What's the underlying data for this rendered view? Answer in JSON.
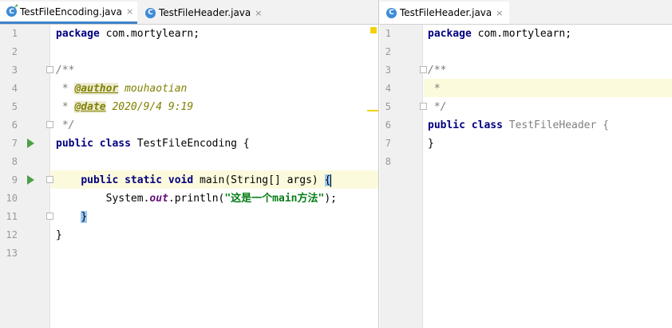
{
  "left_editor": {
    "tabs": [
      {
        "label": "TestFileEncoding.java",
        "icon": "java-class-icon",
        "icon_letter": "C"
      },
      {
        "label": "TestFileHeader.java",
        "icon": "java-class-icon",
        "icon_letter": "C"
      }
    ],
    "close_glyph": "×",
    "lines": [
      {
        "num": "1"
      },
      {
        "num": "2"
      },
      {
        "num": "3"
      },
      {
        "num": "4"
      },
      {
        "num": "5"
      },
      {
        "num": "6"
      },
      {
        "num": "7"
      },
      {
        "num": "8"
      },
      {
        "num": "9"
      },
      {
        "num": "10"
      },
      {
        "num": "11"
      },
      {
        "num": "12"
      },
      {
        "num": "13"
      }
    ],
    "code": {
      "l1_kw": "package",
      "l1_rest": " com.mortylearn;",
      "l3": "/**",
      "l4_star": " * ",
      "l4_tag": "@author",
      "l4_val": " mouhaotian",
      "l5_star": " * ",
      "l5_tag": "@date",
      "l5_val": " 2020/9/4 9:19",
      "l6": " */",
      "l7_kw": "public class",
      "l7_rest": " TestFileEncoding {",
      "l9_indent": "    ",
      "l9_kw": "public static void",
      "l9_rest": " main(String[] args) ",
      "l9_brace": "{",
      "l10_indent": "        ",
      "l10_a": "System.",
      "l10_field": "out",
      "l10_b": ".println(",
      "l10_str": "\"这是一个main方法\"",
      "l10_c": ");",
      "l11_indent": "    ",
      "l11_brace": "}",
      "l12": "}"
    }
  },
  "right_editor": {
    "tabs": [
      {
        "label": "TestFileHeader.java",
        "icon": "java-class-icon",
        "icon_letter": "C"
      }
    ],
    "close_glyph": "×",
    "lines": [
      {
        "num": "1"
      },
      {
        "num": "2"
      },
      {
        "num": "3"
      },
      {
        "num": "4"
      },
      {
        "num": "5"
      },
      {
        "num": "6"
      },
      {
        "num": "7"
      },
      {
        "num": "8"
      }
    ],
    "code": {
      "l1_kw": "package",
      "l1_rest": " com.mortylearn;",
      "l3": "/**",
      "l4": " *",
      "l5": " */",
      "l6_kw": "public class",
      "l6_rest": " TestFileHeader {",
      "l7": "}"
    }
  },
  "colors": {
    "keyword": "#000080",
    "string": "#067d17",
    "doc_tag": "#808000",
    "current_line": "#fcfadc",
    "tab_underline": "#4083c9",
    "run_gutter": "#4ba046"
  }
}
